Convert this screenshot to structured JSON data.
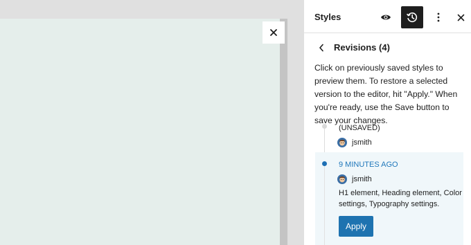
{
  "canvas": {
    "close_icon": "close-icon"
  },
  "sidebar": {
    "title": "Styles",
    "header_icons": [
      "eye-icon",
      "history-icon",
      "more-vertical-icon",
      "close-icon"
    ]
  },
  "revisions": {
    "nav_title": "Revisions (4)",
    "description": "Click on previously saved styles to preview them. To restore a selected version to the editor, hit \"Apply.\" When you're ready, use the Save button to save your changes.",
    "items": [
      {
        "label": "(UNSAVED)",
        "author": "jsmith",
        "selected": false
      },
      {
        "label": "9 MINUTES AGO",
        "author": "jsmith",
        "changes": "H1 element, Heading element, Color settings, Typography settings.",
        "selected": true,
        "apply_label": "Apply"
      }
    ]
  },
  "colors": {
    "accent": "#1e73b0",
    "selected_bg": "#f0f7fa",
    "canvas_bg": "#e5eeeb",
    "dark_button": "#1e1e1e"
  }
}
